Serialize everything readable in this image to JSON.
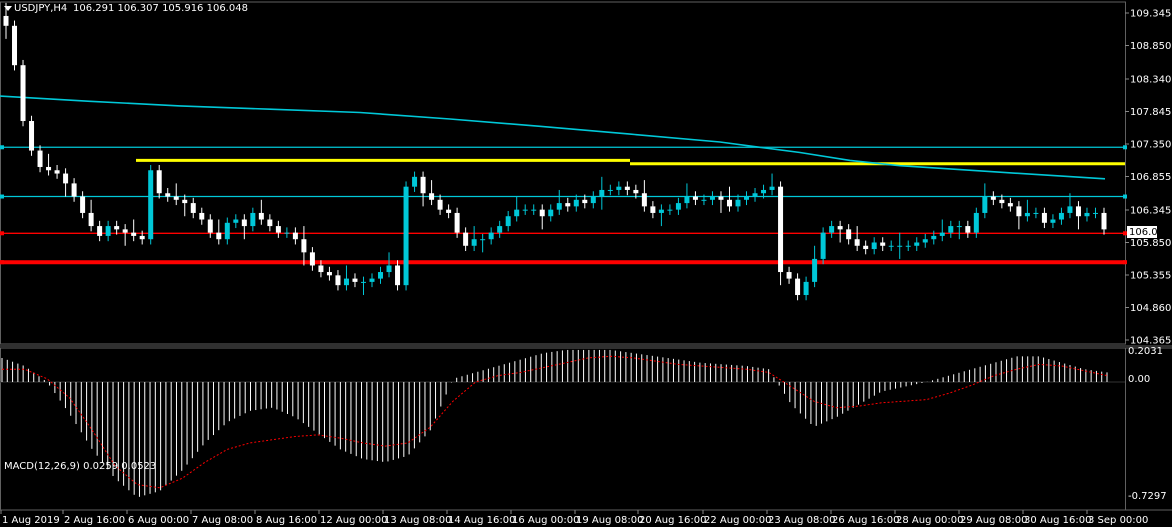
{
  "header": {
    "symbol": "USDJPY,H4",
    "ohlc": "106.291 106.307 105.916 106.048",
    "menu_icon": "triangle-down-icon"
  },
  "colors": {
    "background": "#000000",
    "bull": "#00c8d8",
    "bear": "#ffffff",
    "ma": "#00c8d8",
    "yellow": "#ffff00",
    "red": "#ff0000",
    "hline": "#00c8d8",
    "macd_hist": "#ffffff",
    "macd_signal": "#ff0000"
  },
  "chart_data": [
    {
      "type": "candlestick",
      "title": "USDJPY,H4",
      "ylim": [
        104.3,
        109.55
      ],
      "y_ticks": [
        "109.345",
        "108.850",
        "108.340",
        "107.845",
        "107.350",
        "106.855",
        "106.345",
        "105.850",
        "105.355",
        "104.860",
        "104.365"
      ],
      "x_ticks": [
        "1 Aug 2019",
        "2 Aug 16:00",
        "6 Aug 00:00",
        "7 Aug 08:00",
        "8 Aug 16:00",
        "12 Aug 00:00",
        "13 Aug 08:00",
        "14 Aug 16:00",
        "16 Aug 00:00",
        "19 Aug 08:00",
        "20 Aug 16:00",
        "22 Aug 00:00",
        "23 Aug 08:00",
        "26 Aug 16:00",
        "28 Aug 00:00",
        "29 Aug 08:00",
        "30 Aug 16:00",
        "3 Sep 00:00"
      ],
      "current_price": "106.048",
      "close": [
        109.15,
        108.55,
        107.7,
        107.25,
        107.0,
        106.95,
        106.9,
        106.75,
        106.55,
        106.3,
        106.1,
        105.95,
        106.1,
        106.05,
        106.0,
        105.95,
        105.9,
        106.95,
        106.6,
        106.55,
        106.5,
        106.45,
        106.3,
        106.2,
        106.0,
        105.9,
        106.15,
        106.2,
        106.1,
        106.3,
        106.2,
        106.1,
        106.0,
        106.0,
        105.9,
        105.7,
        105.5,
        105.4,
        105.35,
        105.2,
        105.3,
        105.25,
        105.25,
        105.3,
        105.4,
        105.5,
        105.2,
        106.7,
        106.85,
        106.6,
        106.5,
        106.35,
        106.3,
        106.0,
        105.8,
        105.9,
        105.9,
        106.0,
        106.1,
        106.25,
        106.35,
        106.35,
        106.35,
        106.25,
        106.35,
        106.45,
        106.4,
        106.5,
        106.45,
        106.55,
        106.65,
        106.65,
        106.7,
        106.65,
        106.6,
        106.4,
        106.3,
        106.35,
        106.35,
        106.45,
        106.55,
        106.5,
        106.5,
        106.55,
        106.5,
        106.4,
        106.5,
        106.55,
        106.6,
        106.65,
        106.7,
        105.4,
        105.3,
        105.05,
        105.25,
        105.6,
        106.0,
        106.1,
        106.05,
        105.9,
        105.8,
        105.75,
        105.85,
        105.8,
        105.8,
        105.8,
        105.8,
        105.85,
        105.9,
        105.95,
        106.0,
        106.1,
        106.1,
        106.0,
        106.3,
        106.55,
        106.5,
        106.45,
        106.4,
        106.25,
        106.3,
        106.3,
        106.15,
        106.2,
        106.3,
        106.4,
        106.25,
        106.3,
        106.3,
        106.05
      ],
      "ma_x": [
        0,
        90,
        180,
        270,
        360,
        450,
        540,
        630,
        720,
        760,
        800,
        850,
        900,
        1000,
        1105
      ],
      "ma_y": [
        108.08,
        108.0,
        107.93,
        107.88,
        107.83,
        107.73,
        107.62,
        107.5,
        107.38,
        107.3,
        107.22,
        107.1,
        107.02,
        106.92,
        106.82
      ],
      "hlines": {
        "cyan_upper": 107.3,
        "cyan_lower": 106.55,
        "red_thin": 105.99,
        "red_thick": 105.55,
        "yellow_left": 107.1,
        "yellow_right": 107.05
      }
    },
    {
      "type": "macd",
      "title": "MACD(12,26,9) 0.0259 0.0523",
      "y_ticks": [
        "0.2031",
        "0.00",
        "-0.7297"
      ],
      "ylim": [
        -0.7297,
        0.2031
      ],
      "hist_samples": [
        0.15,
        0.1,
        0.0,
        -0.2,
        -0.42,
        -0.6,
        -0.72,
        -0.68,
        -0.55,
        -0.38,
        -0.25,
        -0.18,
        -0.16,
        -0.22,
        -0.32,
        -0.42,
        -0.48,
        -0.5,
        -0.46,
        -0.3,
        0.02,
        0.06,
        0.1,
        0.14,
        0.18,
        0.2,
        0.2,
        0.2,
        0.18,
        0.16,
        0.14,
        0.12,
        0.11,
        0.1,
        0.08,
        -0.14,
        -0.28,
        -0.22,
        -0.14,
        -0.06,
        -0.03,
        0.0,
        0.04,
        0.08,
        0.12,
        0.16,
        0.16,
        0.12,
        0.08,
        0.06
      ],
      "signal_samples": [
        0.08,
        0.08,
        0.02,
        -0.1,
        -0.3,
        -0.52,
        -0.64,
        -0.66,
        -0.6,
        -0.5,
        -0.42,
        -0.38,
        -0.36,
        -0.34,
        -0.33,
        -0.35,
        -0.38,
        -0.4,
        -0.38,
        -0.28,
        -0.12,
        0.0,
        0.04,
        0.06,
        0.09,
        0.12,
        0.15,
        0.16,
        0.15,
        0.13,
        0.11,
        0.1,
        0.09,
        0.08,
        0.06,
        -0.03,
        -0.12,
        -0.16,
        -0.15,
        -0.13,
        -0.12,
        -0.11,
        -0.07,
        -0.02,
        0.04,
        0.08,
        0.11,
        0.1,
        0.07,
        0.04
      ]
    }
  ]
}
